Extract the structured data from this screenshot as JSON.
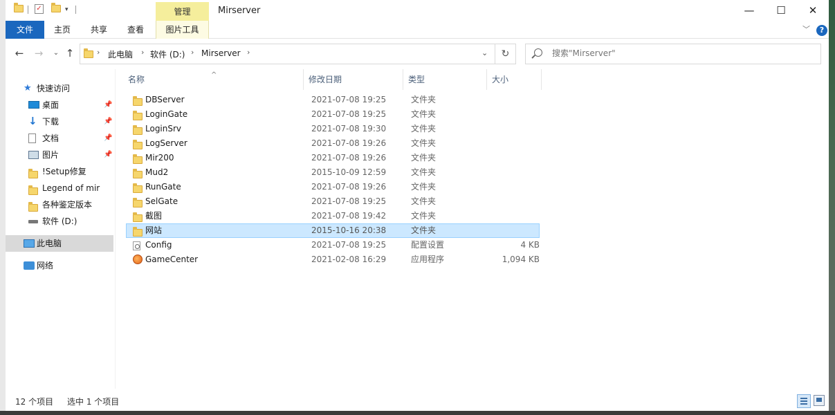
{
  "titlebar": {
    "title": "Mirserver",
    "context_tab": "管理",
    "minimize": "—",
    "maximize": "☐",
    "close": "✕"
  },
  "ribbon": {
    "tabs": [
      {
        "label": "文件"
      },
      {
        "label": "主页"
      },
      {
        "label": "共享"
      },
      {
        "label": "查看"
      },
      {
        "label": "图片工具"
      }
    ],
    "help": "?"
  },
  "address": {
    "crumbs": [
      "此电脑",
      "软件 (D:)",
      "Mirserver"
    ]
  },
  "search": {
    "placeholder": "搜索\"Mirserver\""
  },
  "nav": {
    "items": [
      {
        "label": "快速访问",
        "icon": "star-icon"
      },
      {
        "label": "桌面",
        "icon": "desktop-icon",
        "pinned": true
      },
      {
        "label": "下载",
        "icon": "download-icon",
        "pinned": true
      },
      {
        "label": "文档",
        "icon": "document-icon",
        "pinned": true
      },
      {
        "label": "图片",
        "icon": "picture-icon",
        "pinned": true
      },
      {
        "label": "!Setup修复",
        "icon": "folder-icon"
      },
      {
        "label": "Legend of mir",
        "icon": "folder-icon"
      },
      {
        "label": "各种鉴定版本",
        "icon": "folder-icon"
      },
      {
        "label": "软件 (D:)",
        "icon": "drive-icon"
      },
      {
        "label": "此电脑",
        "icon": "pc-icon",
        "selected": true
      },
      {
        "label": "网络",
        "icon": "network-icon"
      }
    ]
  },
  "columns": [
    "名称",
    "修改日期",
    "类型",
    "大小"
  ],
  "files": [
    {
      "name": "DBServer",
      "date": "2021-07-08 19:25",
      "type": "文件夹",
      "size": "",
      "icon": "folder-icon"
    },
    {
      "name": "LoginGate",
      "date": "2021-07-08 19:25",
      "type": "文件夹",
      "size": "",
      "icon": "folder-icon"
    },
    {
      "name": "LoginSrv",
      "date": "2021-07-08 19:30",
      "type": "文件夹",
      "size": "",
      "icon": "folder-icon"
    },
    {
      "name": "LogServer",
      "date": "2021-07-08 19:26",
      "type": "文件夹",
      "size": "",
      "icon": "folder-icon"
    },
    {
      "name": "Mir200",
      "date": "2021-07-08 19:26",
      "type": "文件夹",
      "size": "",
      "icon": "folder-icon"
    },
    {
      "name": "Mud2",
      "date": "2015-10-09 12:59",
      "type": "文件夹",
      "size": "",
      "icon": "folder-icon"
    },
    {
      "name": "RunGate",
      "date": "2021-07-08 19:26",
      "type": "文件夹",
      "size": "",
      "icon": "folder-icon"
    },
    {
      "name": "SelGate",
      "date": "2021-07-08 19:25",
      "type": "文件夹",
      "size": "",
      "icon": "folder-icon"
    },
    {
      "name": "截图",
      "date": "2021-07-08 19:42",
      "type": "文件夹",
      "size": "",
      "icon": "folder-icon"
    },
    {
      "name": "网站",
      "date": "2015-10-16 20:38",
      "type": "文件夹",
      "size": "",
      "icon": "folder-icon",
      "selected": true
    },
    {
      "name": "Config",
      "date": "2021-07-08 19:25",
      "type": "配置设置",
      "size": "4 KB",
      "icon": "config-file-icon"
    },
    {
      "name": "GameCenter",
      "date": "2021-02-08 16:29",
      "type": "应用程序",
      "size": "1,094 KB",
      "icon": "application-icon"
    }
  ],
  "status": {
    "count": "12 个项目",
    "selected": "选中 1 个项目"
  },
  "colors": {
    "file_tab": "#1a67be",
    "context_tab": "#f5ee9c",
    "selection": "#cce8ff"
  }
}
